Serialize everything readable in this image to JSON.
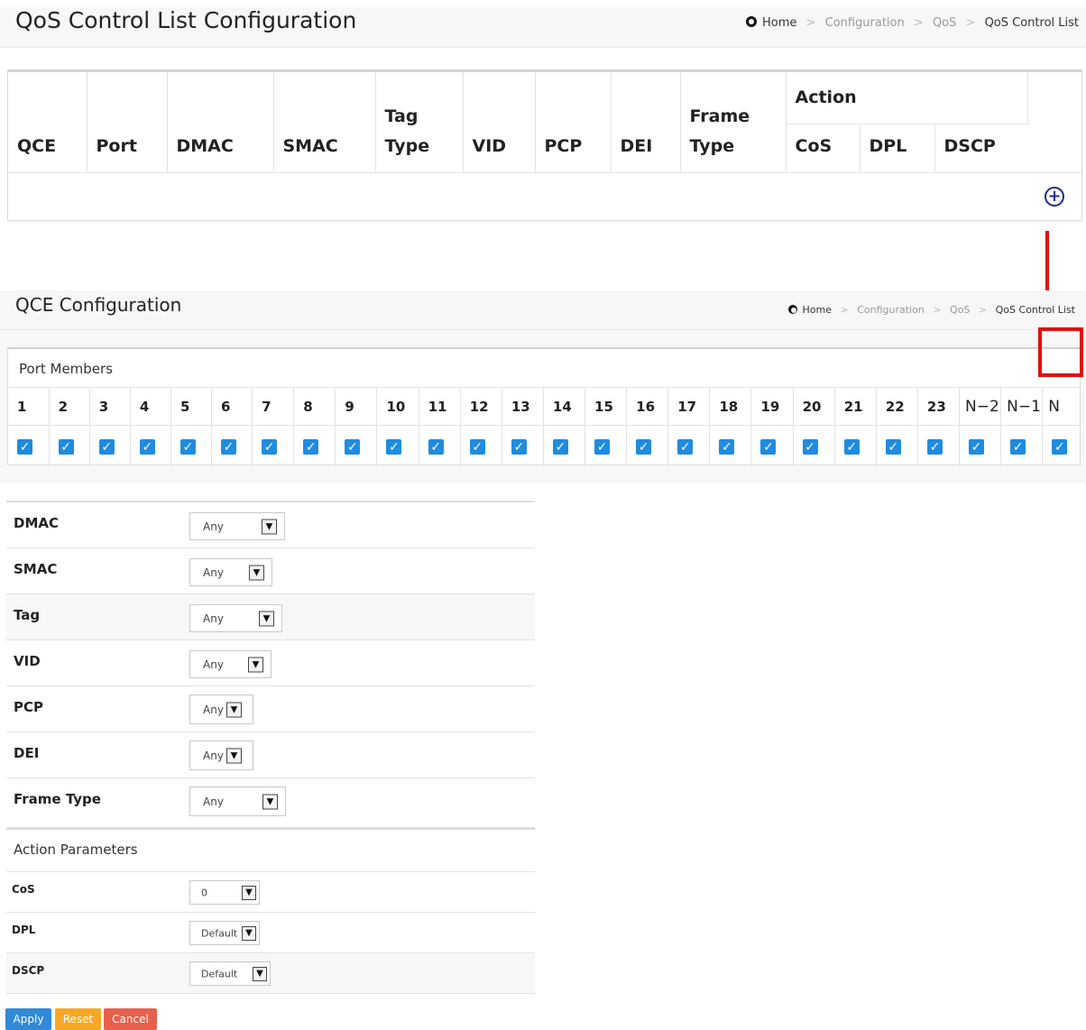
{
  "list_page": {
    "title": "QoS Control List Configuration",
    "breadcrumb": [
      "Home",
      "Configuration",
      "QoS",
      "QoS Control List"
    ],
    "table": {
      "columns": {
        "qce": "QCE",
        "port": "Port",
        "dmac": "DMAC",
        "smac": "SMAC",
        "tag_type": [
          "Tag",
          "Type"
        ],
        "vid": "VID",
        "pcp": "PCP",
        "dei": "DEI",
        "frame_type": [
          "Frame",
          "Type"
        ],
        "action": "Action",
        "cos": "CoS",
        "dpl": "DPL",
        "dscp": "DSCP"
      },
      "add_icon": "plus-circle-icon"
    }
  },
  "config_page": {
    "title": "QCE Configuration",
    "breadcrumb": [
      "Home",
      "Configuration",
      "QoS",
      "QoS Control List"
    ],
    "port_members": {
      "label": "Port Members",
      "ports": [
        "1",
        "2",
        "3",
        "4",
        "5",
        "6",
        "7",
        "8",
        "9",
        "10",
        "11",
        "12",
        "13",
        "14",
        "15",
        "16",
        "17",
        "18",
        "19",
        "20",
        "21",
        "22",
        "23",
        "N−2",
        "N−1",
        "N"
      ],
      "checked": [
        true,
        true,
        true,
        true,
        true,
        true,
        true,
        true,
        true,
        true,
        true,
        true,
        true,
        true,
        true,
        true,
        true,
        true,
        true,
        true,
        true,
        true,
        true,
        true,
        true,
        true
      ]
    },
    "fields": [
      {
        "label": "DMAC",
        "value": "Any"
      },
      {
        "label": "SMAC",
        "value": "Any"
      },
      {
        "label": "Tag",
        "value": "Any"
      },
      {
        "label": "VID",
        "value": "Any"
      },
      {
        "label": "PCP",
        "value": "Any"
      },
      {
        "label": "DEI",
        "value": "Any"
      },
      {
        "label": "Frame Type",
        "value": "Any"
      }
    ],
    "action_parameters": {
      "label": "Action Parameters",
      "fields": [
        {
          "label": "CoS",
          "value": "0"
        },
        {
          "label": "DPL",
          "value": "Default"
        },
        {
          "label": "DSCP",
          "value": "Default"
        }
      ]
    },
    "buttons": {
      "apply": "Apply",
      "reset": "Reset",
      "cancel": "Cancel"
    }
  },
  "colors": {
    "annotation": "#e01010",
    "checkbox": "#1e8ce0",
    "apply": "#2f8ad8",
    "reset": "#f7a823",
    "cancel": "#e8604c"
  }
}
